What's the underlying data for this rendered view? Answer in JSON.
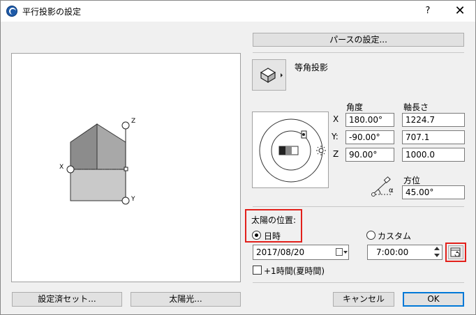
{
  "window": {
    "title": "平行投影の設定",
    "help": "?",
    "close": "✕"
  },
  "preview": {
    "axis_z": "Z",
    "axis_x": "X",
    "axis_y": "Y"
  },
  "right": {
    "perspective_button": "パースの設定...",
    "projection_type": "等角投影",
    "angle_header": "角度",
    "length_header": "軸長さ",
    "rows": [
      {
        "axis": "X",
        "angle": "180.00°",
        "length": "1224.7"
      },
      {
        "axis": "Y:",
        "angle": "-90.00°",
        "length": "707.1"
      },
      {
        "axis": "Z",
        "angle": "90.00°",
        "length": "1000.0"
      }
    ],
    "azimuth_label": "方位",
    "azimuth_value": "45.00°",
    "azimuth_symbol": "α"
  },
  "sun": {
    "section_label": "太陽の位置:",
    "datetime_label": "日時",
    "custom_label": "カスタム",
    "date_value": "2017/08/20",
    "time_value": "7:00:00",
    "dst_label": "+1時間(夏時間)"
  },
  "footer": {
    "preset_button": "設定済セット...",
    "sunlight_button": "太陽光...",
    "cancel_button": "キャンセル",
    "ok_button": "OK"
  },
  "colors": {
    "highlight": "#e2201b",
    "ok_border": "#0078d7"
  }
}
